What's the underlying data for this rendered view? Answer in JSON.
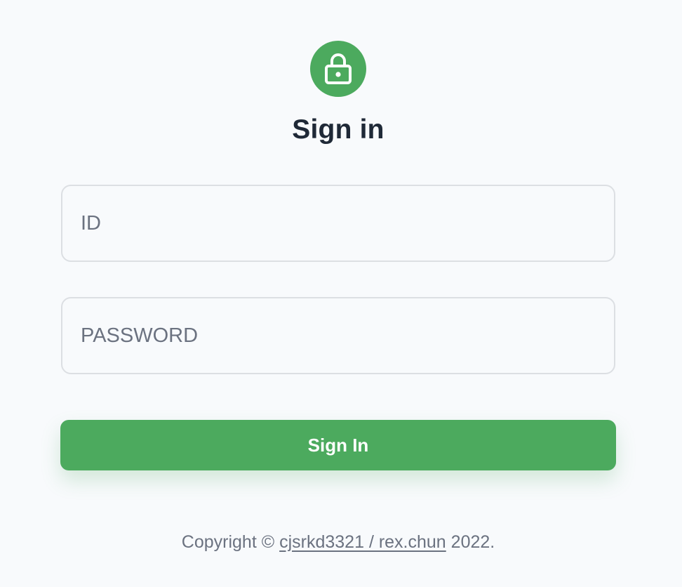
{
  "header": {
    "icon": "lock-icon",
    "title": "Sign in"
  },
  "form": {
    "id_placeholder": "ID",
    "id_value": "",
    "password_placeholder": "PASSWORD",
    "password_value": "",
    "submit_label": "Sign In"
  },
  "footer": {
    "prefix": "Copyright ©",
    "link_text": "cjsrkd3321 / rex.chun",
    "suffix": "2022."
  },
  "colors": {
    "accent": "#4caa5e",
    "background": "#f8fafc",
    "title_text": "#1f2937",
    "muted_text": "#6b7280",
    "field_border": "#dcdfe3"
  }
}
